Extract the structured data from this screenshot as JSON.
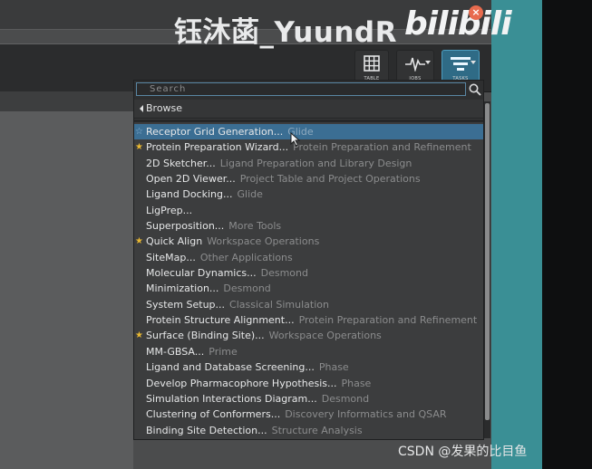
{
  "watermark": {
    "channel_text": "钰沐菡_YuundR",
    "logo_text": "bilibili",
    "close_symbol": "×",
    "footer_text": "CSDN @发果的比目鱼"
  },
  "toolbar": {
    "buttons": [
      {
        "label": "TABLE",
        "icon": "table-grid-icon"
      },
      {
        "label": "JOBS",
        "icon": "jobs-pulse-icon"
      },
      {
        "label": "TASKS",
        "icon": "tasks-list-icon"
      }
    ]
  },
  "task_popup": {
    "search_placeholder": "Search",
    "browse_label": "Browse",
    "tasks": [
      {
        "name": "Receptor Grid Generation...",
        "category": "Glide",
        "favorite": "outline",
        "selected": true
      },
      {
        "name": "Protein Preparation Wizard...",
        "category": "Protein Preparation and Refinement",
        "favorite": "star",
        "selected": false
      },
      {
        "name": "2D Sketcher...",
        "category": "Ligand Preparation and Library Design",
        "favorite": "none",
        "selected": false
      },
      {
        "name": "Open 2D Viewer...",
        "category": "Project Table and Project Operations",
        "favorite": "none",
        "selected": false
      },
      {
        "name": "Ligand Docking...",
        "category": "Glide",
        "favorite": "none",
        "selected": false
      },
      {
        "name": "LigPrep...",
        "category": "",
        "favorite": "none",
        "selected": false
      },
      {
        "name": "Superposition...",
        "category": "More Tools",
        "favorite": "none",
        "selected": false
      },
      {
        "name": "Quick Align",
        "category": "Workspace Operations",
        "favorite": "star",
        "selected": false
      },
      {
        "name": "SiteMap...",
        "category": "Other Applications",
        "favorite": "none",
        "selected": false
      },
      {
        "name": "Molecular Dynamics...",
        "category": "Desmond",
        "favorite": "none",
        "selected": false
      },
      {
        "name": "Minimization...",
        "category": "Desmond",
        "favorite": "none",
        "selected": false
      },
      {
        "name": "System Setup...",
        "category": "Classical Simulation",
        "favorite": "none",
        "selected": false
      },
      {
        "name": "Protein Structure Alignment...",
        "category": "Protein Preparation and Refinement",
        "favorite": "none",
        "selected": false
      },
      {
        "name": "Surface (Binding Site)...",
        "category": "Workspace Operations",
        "favorite": "star",
        "selected": false
      },
      {
        "name": "MM-GBSA...",
        "category": "Prime",
        "favorite": "none",
        "selected": false
      },
      {
        "name": "Ligand and Database Screening...",
        "category": "Phase",
        "favorite": "none",
        "selected": false
      },
      {
        "name": "Develop Pharmacophore Hypothesis...",
        "category": "Phase",
        "favorite": "none",
        "selected": false
      },
      {
        "name": "Simulation Interactions Diagram...",
        "category": "Desmond",
        "favorite": "none",
        "selected": false
      },
      {
        "name": "Clustering of Conformers...",
        "category": "Discovery Informatics and QSAR",
        "favorite": "none",
        "selected": false
      },
      {
        "name": "Binding Site Detection...",
        "category": "Structure Analysis",
        "favorite": "none",
        "selected": false
      }
    ]
  },
  "colors": {
    "selection": "#3b6e93",
    "favorite_star": "#e9b832",
    "teal_panel": "#3a8f95"
  }
}
